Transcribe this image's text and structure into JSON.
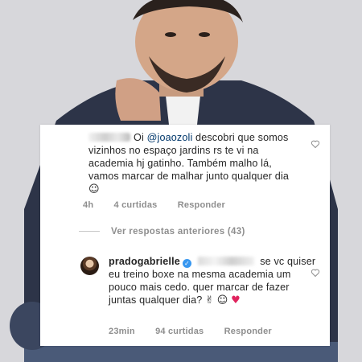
{
  "comment1": {
    "mention": "@joaozoli",
    "greeting": "Oi",
    "text": " descobri que somos vizinhos no espaço jardins rs te vi na academia hj gatinho. Também malho lá, vamos marcar de malhar junto qualquer dia",
    "emoji": "☺",
    "time": "4h",
    "likes": "4 curtidas",
    "reply": "Responder"
  },
  "view_previous": "Ver respostas anteriores (43)",
  "comment2": {
    "username": "pradogabrielle",
    "verified": "✓",
    "text": "se vc quiser eu treino boxe na mesma academia um pouco mais cedo. quer marcar de fazer juntas qualquer dia?",
    "emojis": [
      "✌",
      "☺",
      "♥"
    ],
    "time": "23min",
    "likes": "94 curtidas",
    "reply": "Responder"
  },
  "colors": {
    "link": "#00376b",
    "meta": "#8e8e8e",
    "text": "#262626",
    "verified": "#3897f0"
  },
  "icons": [
    "heart-outline-icon",
    "verified-badge-icon"
  ]
}
